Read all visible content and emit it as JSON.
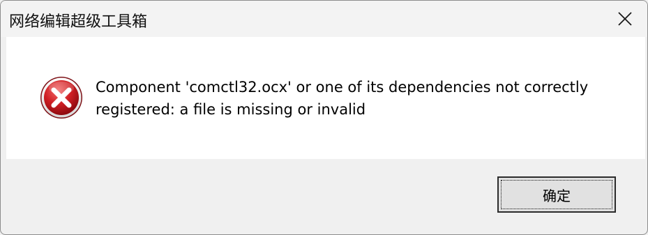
{
  "window": {
    "title": "网络编辑超级工具箱"
  },
  "dialog": {
    "icon": "error-icon",
    "message_line1": "Component 'comctl32.ocx' or one of its dependencies not correctly",
    "message_line2": "registered: a file is missing or invalid"
  },
  "buttons": {
    "ok_label": "确定"
  },
  "colors": {
    "error_red": "#c4131a",
    "content_bg": "#ffffff",
    "chrome_bg": "#f0f0f0"
  }
}
